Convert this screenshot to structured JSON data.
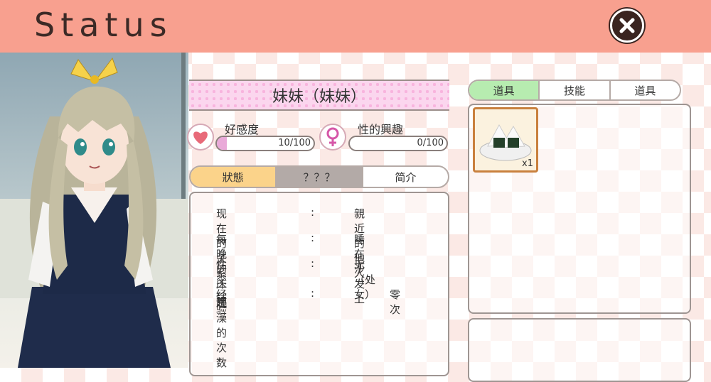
{
  "header": {
    "title": "Status"
  },
  "character": {
    "name": "妹妹（妹妹）"
  },
  "stats": [
    {
      "label": "好感度",
      "value_text": "10/100",
      "fraction": 0.1,
      "icon": "heart-icon"
    },
    {
      "label": "性的興趣",
      "value_text": "0/100",
      "fraction": 0.0,
      "icon": "female-symbol-icon"
    }
  ],
  "info_tabs": [
    {
      "label": "狀態",
      "active": true
    },
    {
      "label": "？？？",
      "active": false
    },
    {
      "label": "简介",
      "active": false
    }
  ],
  "info_rows": [
    {
      "label": "现在的关系",
      "colon": ":",
      "value": "親近的他人"
    },
    {
      "label": "每晚的床铺",
      "colon": ":",
      "value": "睡在沙发上"
    },
    {
      "label": "性交经验",
      "colon": ":",
      "value": "无（处女）"
    },
    {
      "label_line1": "一起",
      "label_line2": "洗澡的次数",
      "colon": ":",
      "value": "零次"
    }
  ],
  "item_tabs": [
    {
      "label": "道具",
      "active": true
    },
    {
      "label": "技能",
      "active": false
    },
    {
      "label": "道具",
      "active": false
    }
  ],
  "inventory": [
    {
      "icon": "onigiri-icon",
      "count": "x1"
    }
  ],
  "colors": {
    "header": "#f8a08f",
    "active_tab_orange": "#fbd38a",
    "active_tab_green": "#b7ecb0",
    "unknown_tab": "#b3aaa7",
    "bar_fill": "#e9a9d8"
  }
}
